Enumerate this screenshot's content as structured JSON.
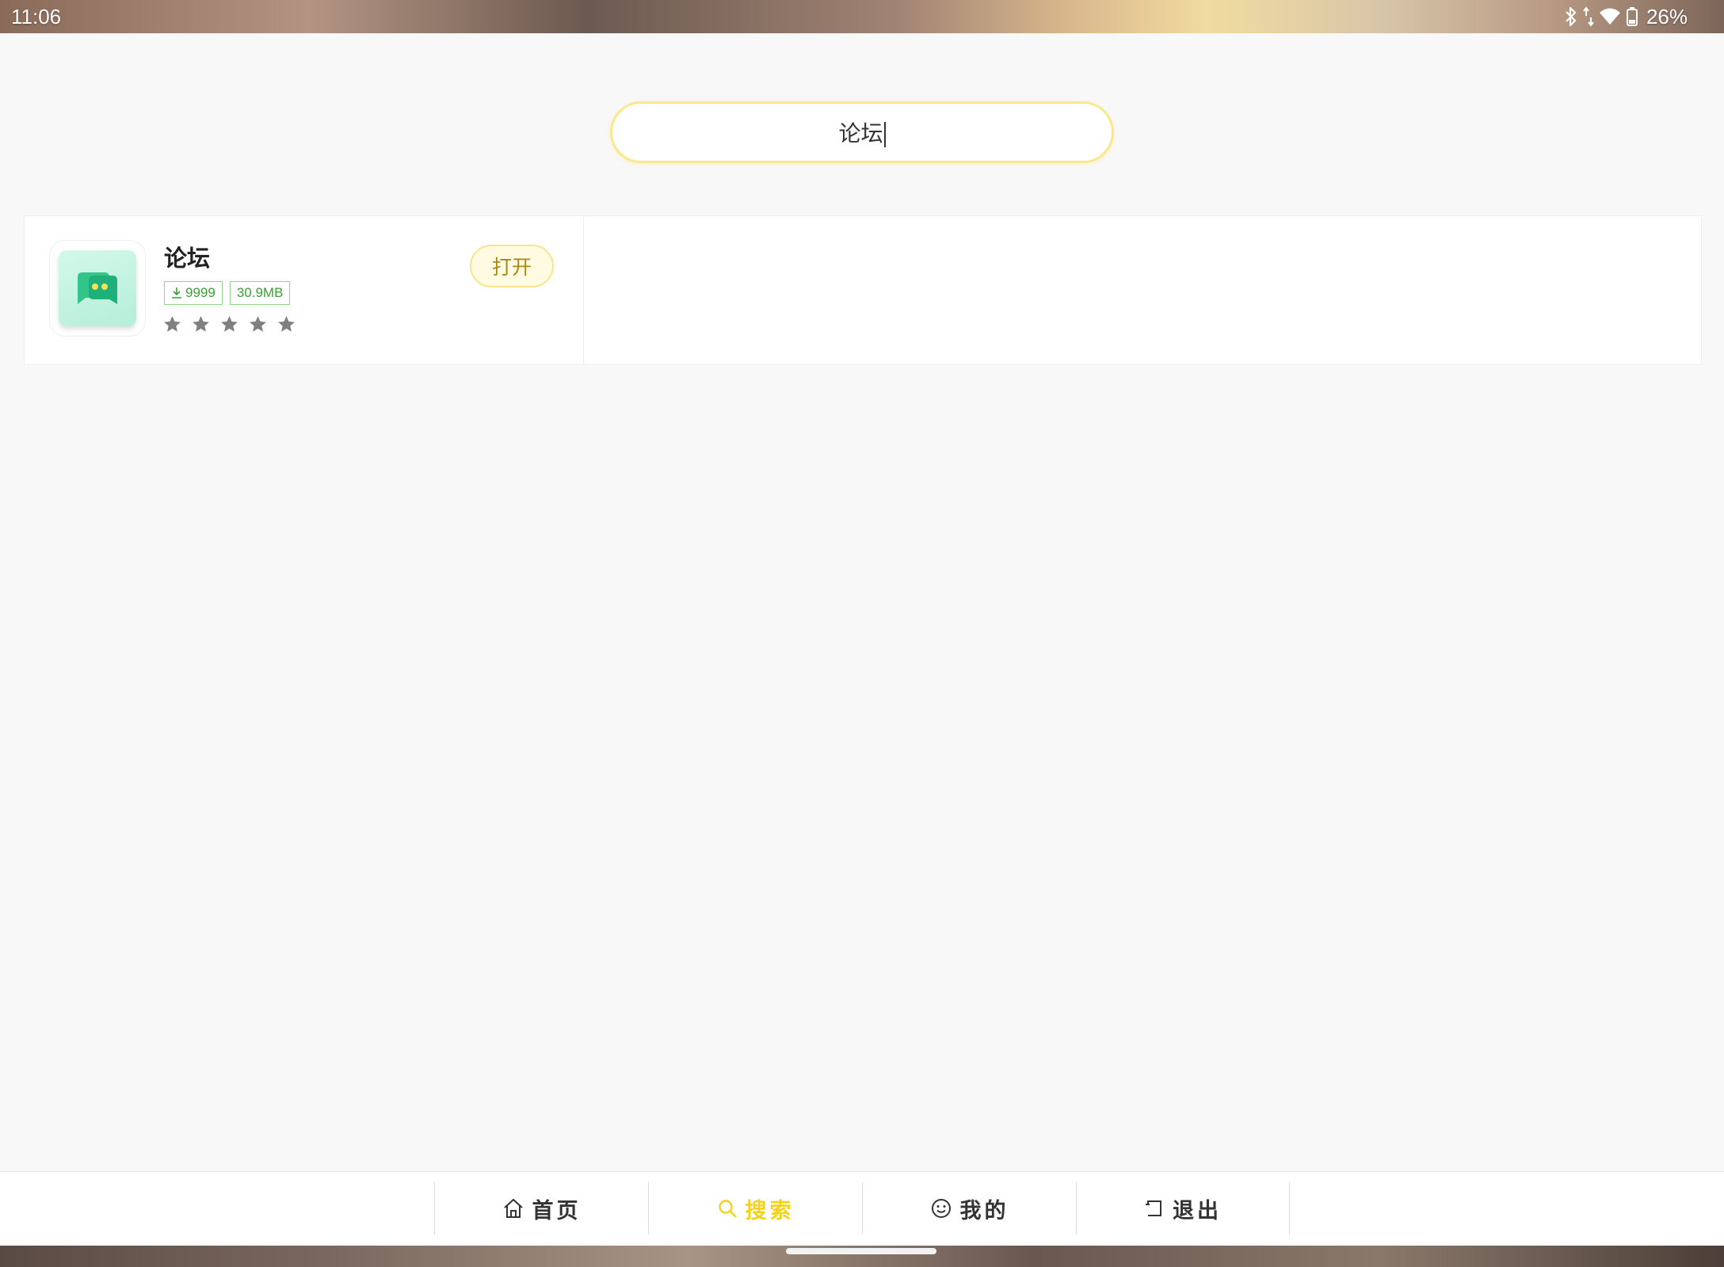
{
  "status_bar": {
    "time": "11:06",
    "battery": "26%",
    "icons": [
      "bluetooth-icon",
      "data-arrows-icon",
      "wifi-icon",
      "battery-icon"
    ]
  },
  "search": {
    "value": "论坛",
    "border_color": "#fbe88a"
  },
  "results": [
    {
      "name": "论坛",
      "downloads": "9999",
      "size": "30.9MB",
      "rating_max": 5,
      "action_label": "打开",
      "icon": "chat-bubbles-icon"
    }
  ],
  "nav": {
    "items": [
      {
        "label": "首页",
        "icon": "home-icon"
      },
      {
        "label": "搜索",
        "icon": "search-icon",
        "active": true
      },
      {
        "label": "我的",
        "icon": "smiley-icon"
      },
      {
        "label": "退出",
        "icon": "exit-icon"
      }
    ],
    "active_color": "#f5d21a"
  }
}
